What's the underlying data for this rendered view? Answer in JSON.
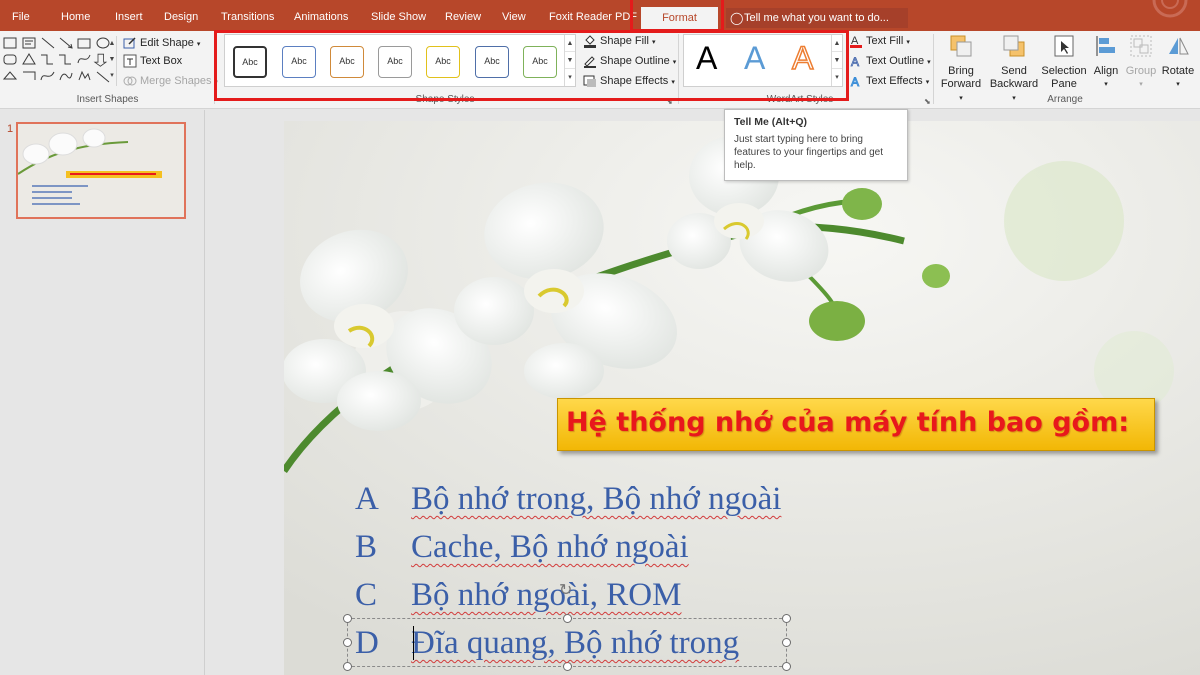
{
  "tabs": [
    {
      "label": "File"
    },
    {
      "label": "Home"
    },
    {
      "label": "Insert"
    },
    {
      "label": "Design"
    },
    {
      "label": "Transitions"
    },
    {
      "label": "Animations"
    },
    {
      "label": "Slide Show"
    },
    {
      "label": "Review"
    },
    {
      "label": "View"
    },
    {
      "label": "Foxit Reader PDF"
    },
    {
      "label": "Format"
    }
  ],
  "active_tab": "Format",
  "tell_me": {
    "text": "Tell me what you want to do..."
  },
  "ribbon": {
    "insert_shapes": {
      "label": "Insert Shapes",
      "edit_shape": "Edit Shape",
      "text_box": "Text Box",
      "merge_shapes": "Merge Shapes"
    },
    "shape_styles": {
      "label": "Shape Styles",
      "gallery": [
        {
          "text": "Abc",
          "color": "#333333"
        },
        {
          "text": "Abc",
          "color": "#5b7fc1"
        },
        {
          "text": "Abc",
          "color": "#d08a3a"
        },
        {
          "text": "Abc",
          "color": "#9a9a9a"
        },
        {
          "text": "Abc",
          "color": "#e1c11c"
        },
        {
          "text": "Abc",
          "color": "#4f6fa8"
        },
        {
          "text": "Abc",
          "color": "#7fb25a"
        }
      ],
      "shape_fill": "Shape Fill",
      "shape_outline": "Shape Outline",
      "shape_effects": "Shape Effects"
    },
    "wordart_styles": {
      "label": "WordArt Styles",
      "letters": [
        {
          "text": "A",
          "color": "#000000"
        },
        {
          "text": "A",
          "color": "#5b9bd5"
        },
        {
          "text": "A",
          "color": "#f4b183"
        }
      ],
      "text_fill": "Text Fill",
      "text_outline": "Text Outline",
      "text_effects": "Text Effects"
    },
    "arrange": {
      "label": "Arrange",
      "bring_forward": [
        "Bring",
        "Forward"
      ],
      "send_backward": [
        "Send",
        "Backward"
      ],
      "selection_pane": [
        "Selection",
        "Pane"
      ],
      "align": "Align",
      "group": "Group",
      "rotate": "Rotate"
    }
  },
  "tooltip": {
    "title": "Tell Me (Alt+Q)",
    "body": "Just start typing here to bring features to your fingertips and get help."
  },
  "thumbnail": {
    "number": "1"
  },
  "slide": {
    "title": "Hệ thống nhớ của máy tính bao gồm:",
    "answers": [
      {
        "letter": "A",
        "text": "Bộ nhớ trong, Bộ nhớ ngoài"
      },
      {
        "letter": "B",
        "text": "Cache, Bộ nhớ ngoài"
      },
      {
        "letter": "C",
        "text": "Bộ nhớ ngoài, ROM"
      },
      {
        "letter": "D",
        "text": "Đĩa quang, Bộ nhớ trong"
      }
    ]
  },
  "colors": {
    "accent": "#b7472a",
    "highlight_box": "#e41b1b",
    "title_text": "#e8181c",
    "title_fill": "#f2b705",
    "answer_text": "#3b5fa8"
  }
}
